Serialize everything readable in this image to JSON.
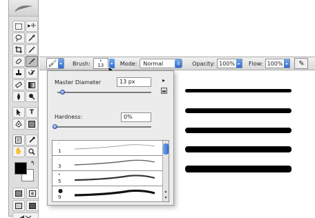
{
  "options_bar": {
    "brush_label": "Brush:",
    "brush_size": "13",
    "mode_label": "Mode:",
    "mode_value": "Normal",
    "opacity_label": "Opacity:",
    "opacity_value": "100%",
    "flow_label": "Flow:",
    "flow_value": "100%"
  },
  "brush_panel": {
    "master_diameter_label": "Master Diameter",
    "master_diameter_value": "13 px",
    "master_diameter_fraction": 0.05,
    "hardness_label": "Hardness:",
    "hardness_value": "0%",
    "hardness_fraction": 0.0,
    "presets": [
      {
        "size": "1"
      },
      {
        "size": "3"
      },
      {
        "size": "5"
      },
      {
        "size": "9"
      }
    ]
  },
  "icons": {
    "tools": [
      "marquee-icon",
      "move-icon",
      "lasso-icon",
      "magic-wand-icon",
      "crop-icon",
      "slice-icon",
      "healing-brush-icon",
      "brush-icon",
      "clone-stamp-icon",
      "history-brush-icon",
      "eraser-icon",
      "gradient-icon",
      "blur-icon",
      "dodge-icon",
      "path-selection-icon",
      "type-icon",
      "pen-icon",
      "shape-icon",
      "notes-icon",
      "eyedropper-icon",
      "hand-icon",
      "zoom-icon"
    ]
  },
  "colors": {
    "foreground": "#000000",
    "background": "#ffffff",
    "accent": "#2f6bd1"
  }
}
